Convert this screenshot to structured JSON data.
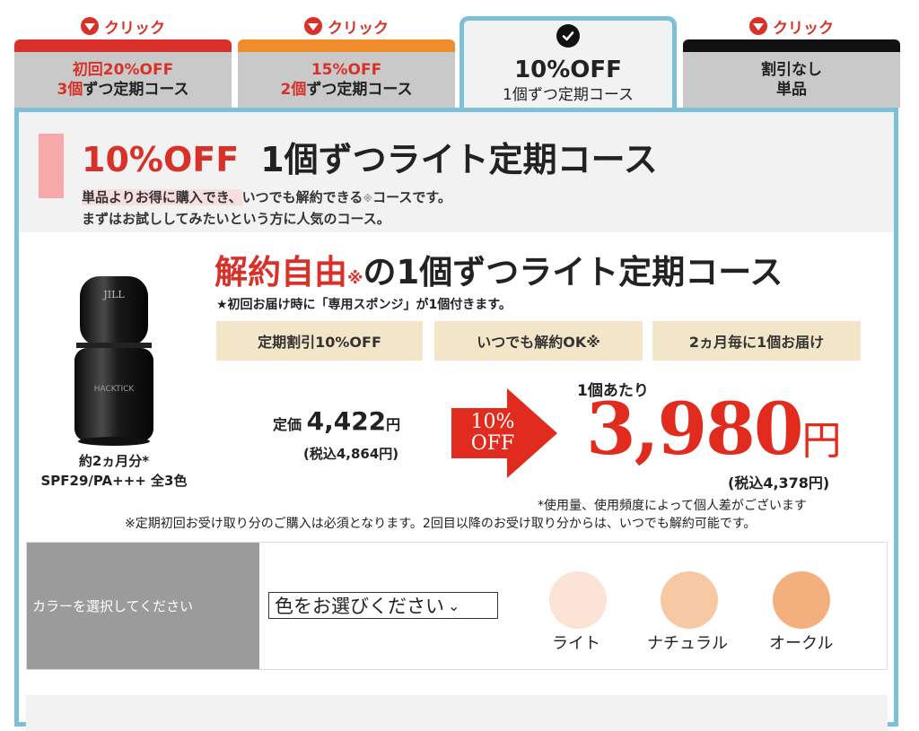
{
  "tabs": [
    {
      "click_label": "クリック",
      "line1": "初回20%OFF",
      "line2_highlight": "3個",
      "line2_rest": "ずつ定期コース",
      "bar_color": "#d8312a"
    },
    {
      "click_label": "クリック",
      "line1": "15%OFF",
      "line2_highlight": "2個",
      "line2_rest": "ずつ定期コース",
      "bar_color": "#ef8c2c"
    },
    {
      "line1": "10%OFF",
      "line2": "1個ずつ定期コース",
      "active": true
    },
    {
      "click_label": "クリック",
      "line1": "割引なし",
      "line2": "単品",
      "bar_color": "#111111"
    }
  ],
  "header": {
    "discount": "10%OFF",
    "title": "1個ずつライト定期コース",
    "desc_highlight": "単品よりお得に購入でき、",
    "desc_rest": "いつでも解約できる",
    "desc_kome": "※",
    "desc_end": "コースです。",
    "desc_line2": "まずはお試ししてみたいという方に人気のコース。"
  },
  "product": {
    "brand_text": "HACKTICK",
    "caption_line1": "約2ヵ月分*",
    "caption_line2": "SPF29/PA+++ 全3色"
  },
  "course": {
    "title_red": "解約自由",
    "title_kome": "※",
    "title_rest": "の1個ずつライト定期コース",
    "gift": "★初回お届け時に「専用スポンジ」が1個付きます。",
    "features": [
      "定期割引10%OFF",
      "いつでも解約OK※",
      "2ヵ月毎に1個お届け"
    ]
  },
  "pricing": {
    "list_label": "定価",
    "list_price": "4,422",
    "list_yen": "円",
    "list_tax": "(税込4,864円)",
    "badge_line1": "10%",
    "badge_line2": "OFF",
    "per_unit": "1個あたり",
    "sale_price": "3,980",
    "sale_yen": "円",
    "sale_tax": "(税込4,378円)"
  },
  "notes": {
    "note1": "*使用量、使用頻度によって個人差がございます",
    "note2": "※定期初回お受け取り分のご購入は必須となります。2回目以降のお受け取り分からは、いつでも解約可能です。"
  },
  "color_selector": {
    "label": "カラーを選択してください",
    "select_value": "色をお選びください",
    "swatches": [
      {
        "name": "ライト",
        "color": "#fbe3d6"
      },
      {
        "name": "ナチュラル",
        "color": "#f7c8a4"
      },
      {
        "name": "オークル",
        "color": "#f3b07c"
      }
    ]
  },
  "colors": {
    "accent": "#d8312a",
    "frame": "#7cc0d8",
    "price_red": "#e22b1f"
  }
}
